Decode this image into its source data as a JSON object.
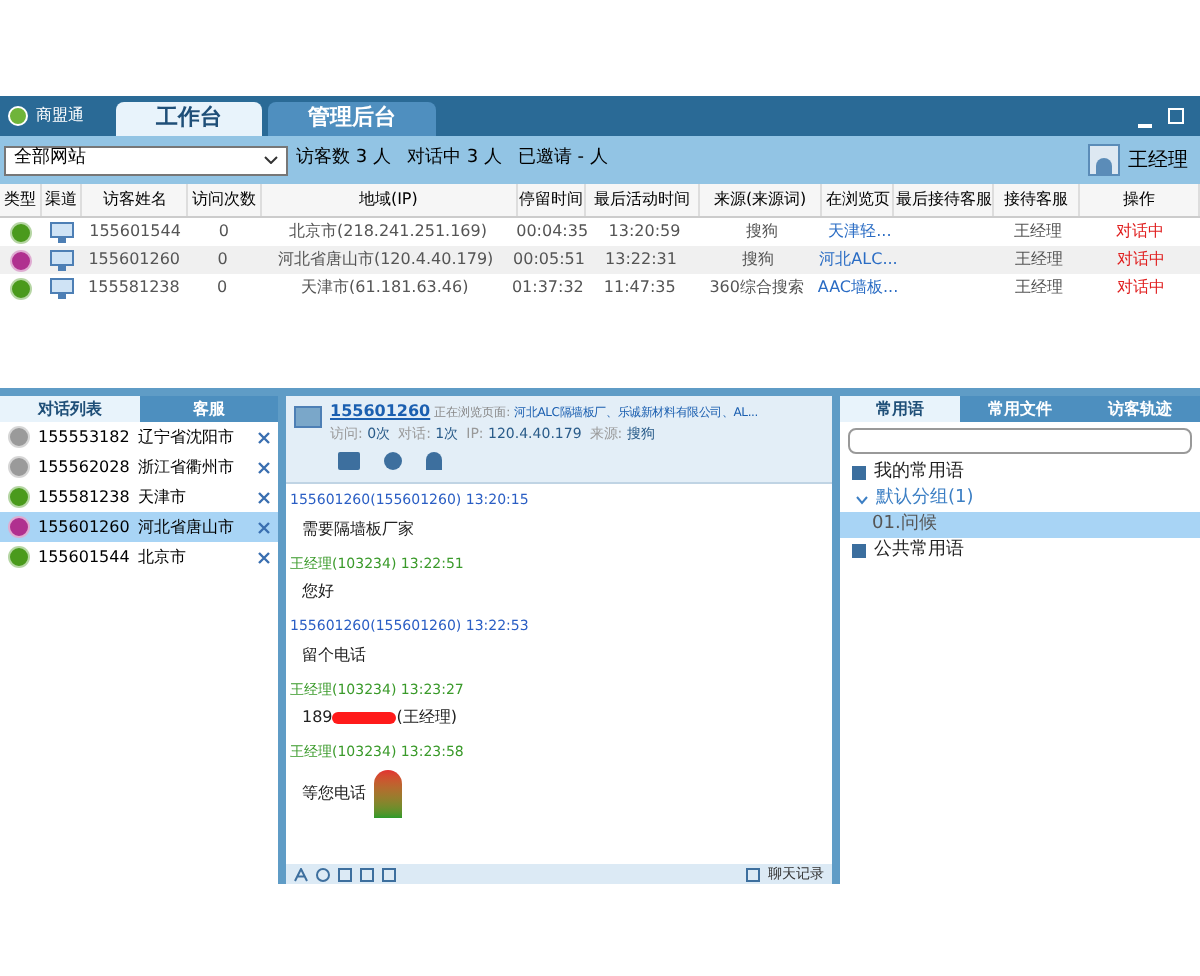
{
  "app": {
    "name": "商盟通",
    "tabs": [
      {
        "label": "工作台",
        "selected": true
      },
      {
        "label": "管理后台",
        "selected": false
      }
    ]
  },
  "toolbar": {
    "site_select": "全部网站",
    "stats": [
      "访客数 3 人",
      "对话中 3 人",
      "已邀请 - 人"
    ],
    "user": "王经理"
  },
  "table": {
    "columns": [
      "类型",
      "渠道",
      "访客姓名",
      "访问次数",
      "地域(IP)",
      "停留时间",
      "最后活动时间",
      "来源(来源词)",
      "在浏览页",
      "最后接待客服",
      "接待客服",
      "操作"
    ],
    "rows": [
      {
        "color": "#4a9a1c",
        "name": "155601544",
        "visits": "0",
        "region": "北京市(218.241.251.169)",
        "stay": "00:04:35",
        "last": "13:20:59",
        "source": "搜狗",
        "page": "天津轻...",
        "last_agent": "",
        "agent": "王经理",
        "action": "对话中"
      },
      {
        "color": "#b0308f",
        "name": "155601260",
        "visits": "0",
        "region": "河北省唐山市(120.4.40.179)",
        "stay": "00:05:51",
        "last": "13:22:31",
        "source": "搜狗",
        "page": "河北ALC...",
        "last_agent": "",
        "agent": "王经理",
        "action": "对话中"
      },
      {
        "color": "#4a9a1c",
        "name": "155581238",
        "visits": "0",
        "region": "天津市(61.181.63.46)",
        "stay": "01:37:32",
        "last": "11:47:35",
        "source": "360综合搜索",
        "page": "AAC墙板...",
        "last_agent": "",
        "agent": "王经理",
        "action": "对话中"
      }
    ]
  },
  "conversations": {
    "tabs": [
      {
        "label": "对话列表",
        "selected": true
      },
      {
        "label": "客服",
        "selected": false
      }
    ],
    "items": [
      {
        "color": "#9a9a9a",
        "id": "155553182",
        "region": "辽宁省沈阳市",
        "selected": false
      },
      {
        "color": "#9a9a9a",
        "id": "155562028",
        "region": "浙江省衢州市",
        "selected": false
      },
      {
        "color": "#4a9a1c",
        "id": "155581238",
        "region": "天津市",
        "selected": false
      },
      {
        "color": "#b0308f",
        "id": "155601260",
        "region": "河北省唐山市",
        "selected": true
      },
      {
        "color": "#4a9a1c",
        "id": "155601544",
        "region": "北京市",
        "selected": false
      }
    ]
  },
  "chat": {
    "visitor": "155601260",
    "browsing_label": "正在浏览页面:",
    "browsing_page": "河北ALC隔墙板厂、乐诚新材料有限公司、AL...",
    "info": [
      {
        "label": "访问:",
        "value": "0次"
      },
      {
        "label": "对话:",
        "value": "1次"
      },
      {
        "label": "IP:",
        "value": "120.4.40.179"
      },
      {
        "label": "来源:",
        "value": "搜狗"
      }
    ],
    "messages": [
      {
        "kind": "visitor",
        "sender": "155601260(155601260)",
        "time": "13:20:15",
        "text": "需要隔墙板厂家"
      },
      {
        "kind": "agent",
        "sender": "王经理(103234)",
        "time": "13:22:51",
        "text": "您好"
      },
      {
        "kind": "visitor",
        "sender": "155601260(155601260)",
        "time": "13:22:53",
        "text": "留个电话"
      },
      {
        "kind": "agent",
        "sender": "王经理(103234)",
        "time": "13:23:27",
        "text": "189",
        "suffix": "(王经理)"
      },
      {
        "kind": "agent",
        "sender": "王经理(103234)",
        "time": "13:23:58",
        "text": "等您电话"
      }
    ],
    "history": "聊天记录"
  },
  "phrases": {
    "tabs": [
      {
        "label": "常用语",
        "selected": true
      },
      {
        "label": "常用文件",
        "selected": false
      },
      {
        "label": "访客轨迹",
        "selected": false
      }
    ],
    "tree": [
      {
        "label": "我的常用语",
        "expanded": true,
        "children": [
          {
            "label": "默认分组(1)",
            "expanded": true,
            "children": [
              {
                "label": "01.问候",
                "selected": true
              }
            ]
          }
        ]
      },
      {
        "label": "公共常用语",
        "expanded": true
      }
    ]
  }
}
